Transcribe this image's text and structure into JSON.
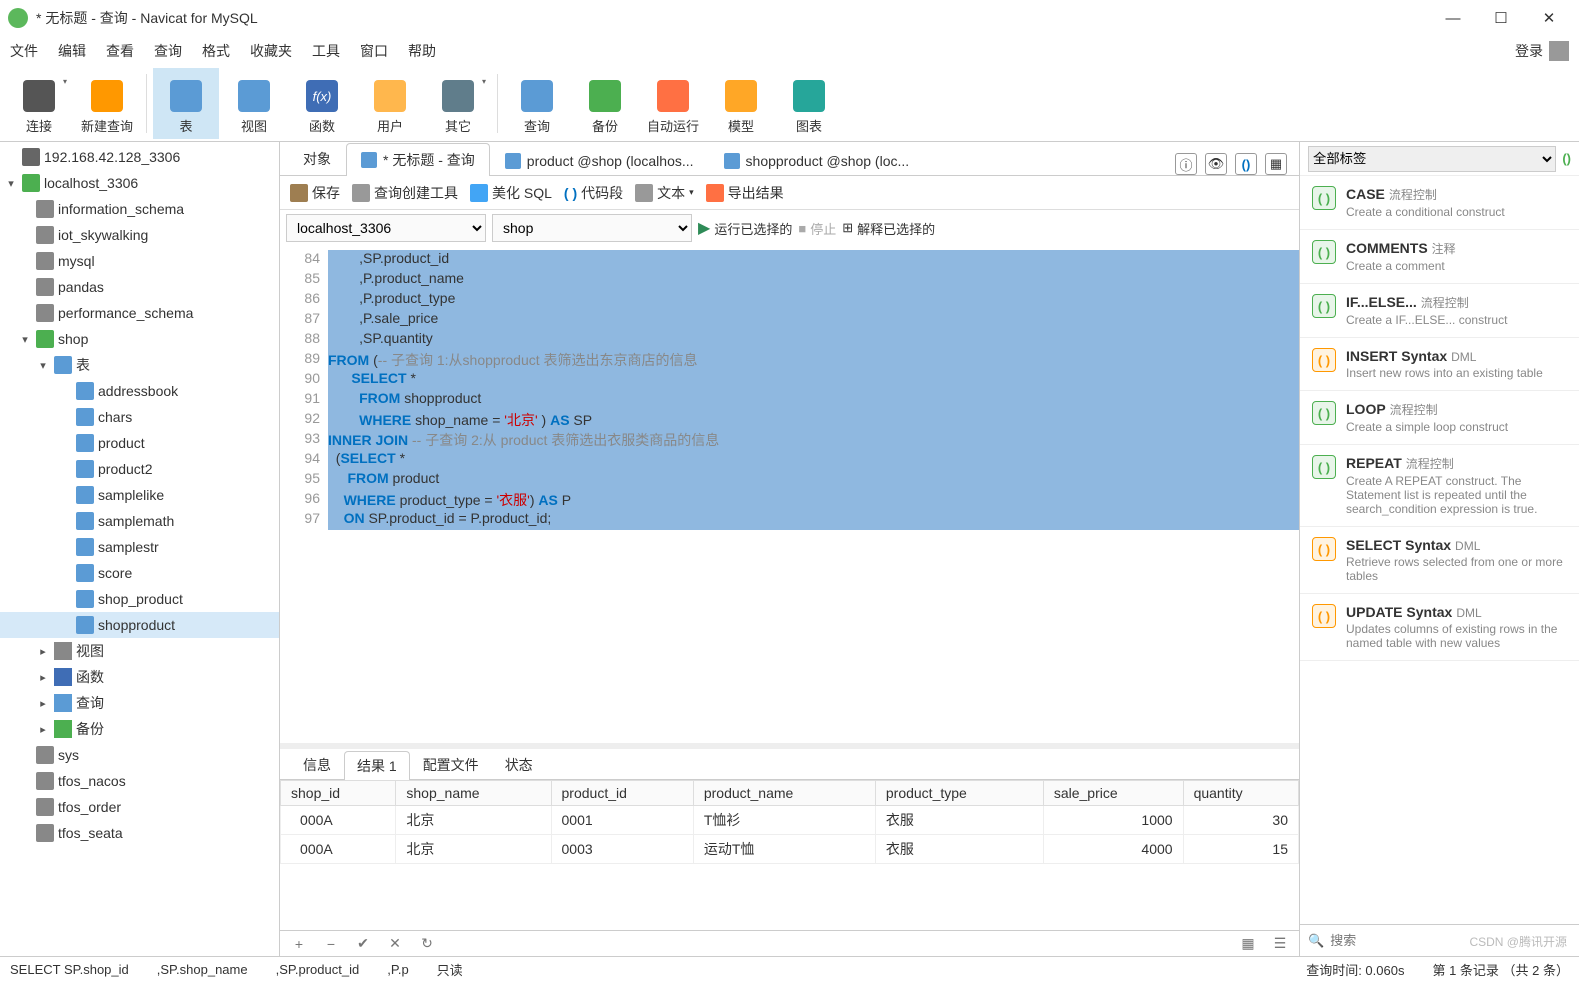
{
  "window": {
    "title": "* 无标题 - 查询 - Navicat for MySQL"
  },
  "menubar": {
    "items": [
      "文件",
      "编辑",
      "查看",
      "查询",
      "格式",
      "收藏夹",
      "工具",
      "窗口",
      "帮助"
    ],
    "login": "登录"
  },
  "toolbar": {
    "items": [
      "连接",
      "新建查询",
      "表",
      "视图",
      "函数",
      "用户",
      "其它",
      "查询",
      "备份",
      "自动运行",
      "模型",
      "图表"
    ]
  },
  "sidebar": {
    "conn1": "192.168.42.128_3306",
    "conn2": "localhost_3306",
    "dbs_top": [
      "information_schema",
      "iot_skywalking",
      "mysql",
      "pandas",
      "performance_schema"
    ],
    "shop": "shop",
    "tables_label": "表",
    "tables": [
      "addressbook",
      "chars",
      "product",
      "product2",
      "samplelike",
      "samplemath",
      "samplestr",
      "score",
      "shop_product",
      "shopproduct"
    ],
    "folders": [
      "视图",
      "函数",
      "查询",
      "备份"
    ],
    "dbs_bottom": [
      "sys",
      "tfos_nacos",
      "tfos_order",
      "tfos_seata"
    ]
  },
  "tabs": {
    "t0": "对象",
    "t1": "* 无标题 - 查询",
    "t2": "product @shop (localhos...",
    "t3": "shopproduct @shop (loc..."
  },
  "qtoolbar": {
    "save": "保存",
    "builder": "查询创建工具",
    "beautify": "美化 SQL",
    "snippet": "代码段",
    "text": "文本",
    "export": "导出结果"
  },
  "selrow": {
    "conn": "localhost_3306",
    "db": "shop",
    "run": "运行已选择的",
    "stop": "停止",
    "explain": "解释已选择的"
  },
  "editor": {
    "lines": [
      {
        "n": 84,
        "html": "        ,SP.product_id"
      },
      {
        "n": 85,
        "html": "        ,P.product_name"
      },
      {
        "n": 86,
        "html": "        ,P.product_type"
      },
      {
        "n": 87,
        "html": "        ,P.sale_price"
      },
      {
        "n": 88,
        "html": "        ,SP.quantity"
      },
      {
        "n": 89,
        "html": "<span class='kw'>FROM</span> (<span class='cm'>-- 子查询 1:从shopproduct 表筛选出东京商店的信息</span>"
      },
      {
        "n": 90,
        "html": "      <span class='kw'>SELECT</span> *"
      },
      {
        "n": 91,
        "html": "        <span class='kw'>FROM</span> shopproduct"
      },
      {
        "n": 92,
        "html": "        <span class='kw'>WHERE</span> shop_name = <span class='str'>'北京'</span> ) <span class='kw'>AS</span> SP"
      },
      {
        "n": 93,
        "html": "<span class='kw'>INNER JOIN</span> <span class='cm'>-- 子查询 2:从 product 表筛选出衣服类商品的信息</span>"
      },
      {
        "n": 94,
        "html": "  (<span class='kw'>SELECT</span> *"
      },
      {
        "n": 95,
        "html": "     <span class='kw'>FROM</span> product"
      },
      {
        "n": 96,
        "html": "    <span class='kw'>WHERE</span> product_type = <span class='str'>'衣服'</span>) <span class='kw'>AS</span> P"
      },
      {
        "n": 97,
        "html": "    <span class='kw'>ON</span> SP.product_id = P.product_id;"
      }
    ]
  },
  "rtabs": {
    "info": "信息",
    "result": "结果 1",
    "profile": "配置文件",
    "status": "状态"
  },
  "results": {
    "cols": [
      "shop_id",
      "shop_name",
      "product_id",
      "product_name",
      "product_type",
      "sale_price",
      "quantity"
    ],
    "rows": [
      [
        "000A",
        "北京",
        "0001",
        "T恤衫",
        "衣服",
        "1000",
        "30"
      ],
      [
        "000A",
        "北京",
        "0003",
        "运动T恤",
        "衣服",
        "4000",
        "15"
      ]
    ]
  },
  "right": {
    "tagsel": "全部标签",
    "snips": [
      {
        "title": "CASE",
        "tag": "流程控制",
        "desc": "Create a conditional construct",
        "c": "g"
      },
      {
        "title": "COMMENTS",
        "tag": "注释",
        "desc": "Create a comment",
        "c": "g"
      },
      {
        "title": "IF...ELSE...",
        "tag": "流程控制",
        "desc": "Create a IF...ELSE... construct",
        "c": "g"
      },
      {
        "title": "INSERT Syntax",
        "tag": "DML",
        "desc": "Insert new rows into an existing table",
        "c": "o"
      },
      {
        "title": "LOOP",
        "tag": "流程控制",
        "desc": "Create a simple loop construct",
        "c": "g"
      },
      {
        "title": "REPEAT",
        "tag": "流程控制",
        "desc": "Create A REPEAT construct. The Statement list is repeated until the search_condition expression is true.",
        "c": "g"
      },
      {
        "title": "SELECT Syntax",
        "tag": "DML",
        "desc": "Retrieve rows selected from one or more tables",
        "c": "o"
      },
      {
        "title": "UPDATE Syntax",
        "tag": "DML",
        "desc": "Updates columns of existing rows in the named table with new values",
        "c": "o"
      }
    ],
    "search_ph": "搜索"
  },
  "status": {
    "sql": "SELECT SP.shop_id",
    "c2": ",SP.shop_name",
    "c3": ",SP.product_id",
    "c4": ",P.p",
    "readonly": "只读",
    "time": "查询时间: 0.060s",
    "records": "第 1 条记录 （共 2 条）"
  },
  "watermark": "CSDN @腾讯开源"
}
